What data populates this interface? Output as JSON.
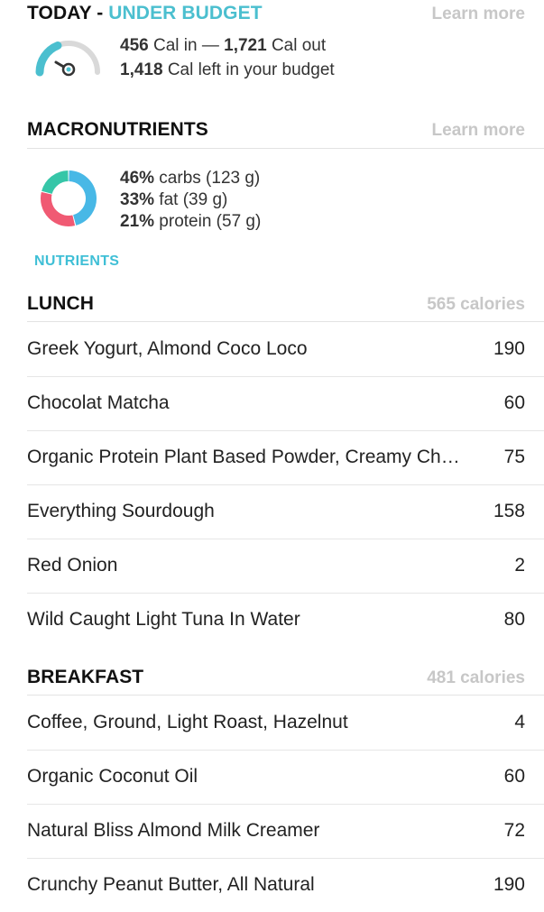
{
  "today": {
    "label": "TODAY - ",
    "status": "UNDER BUDGET",
    "learn_more": "Learn more",
    "cal_in_value": "456",
    "cal_in_label": " Cal in — ",
    "cal_out_value": "1,721",
    "cal_out_label": " Cal out",
    "cal_left_value": "1,418",
    "cal_left_label": " Cal left in your budget",
    "gauge_colors": {
      "track": "#d9d9d9",
      "fill": "#4bbfcf",
      "needle": "#333333"
    }
  },
  "macros": {
    "title": "MACRONUTRIENTS",
    "learn_more": "Learn more",
    "items": [
      {
        "pct": "46%",
        "label": " carbs (123 g)",
        "value": 46,
        "color": "#48b8e6"
      },
      {
        "pct": "33%",
        "label": " fat (39 g)",
        "value": 33,
        "color": "#f05a73"
      },
      {
        "pct": "21%",
        "label": " protein (57 g)",
        "value": 21,
        "color": "#36c6a8"
      }
    ]
  },
  "nutrients_link": "NUTRIENTS",
  "meals": [
    {
      "name": "LUNCH",
      "total": "565 calories",
      "items": [
        {
          "name": "Greek Yogurt, Almond Coco Loco",
          "cal": "190"
        },
        {
          "name": "Chocolat Matcha",
          "cal": "60"
        },
        {
          "name": "Organic Protein Plant Based Powder, Creamy Ch…",
          "cal": "75"
        },
        {
          "name": "Everything Sourdough",
          "cal": "158"
        },
        {
          "name": "Red Onion",
          "cal": "2"
        },
        {
          "name": "Wild Caught Light Tuna In Water",
          "cal": "80"
        }
      ]
    },
    {
      "name": "BREAKFAST",
      "total": "481 calories",
      "items": [
        {
          "name": "Coffee, Ground, Light Roast, Hazelnut",
          "cal": "4"
        },
        {
          "name": "Organic Coconut Oil",
          "cal": "60"
        },
        {
          "name": "Natural Bliss Almond Milk Creamer",
          "cal": "72"
        },
        {
          "name": "Crunchy Peanut Butter, All Natural",
          "cal": "190"
        }
      ]
    }
  ]
}
